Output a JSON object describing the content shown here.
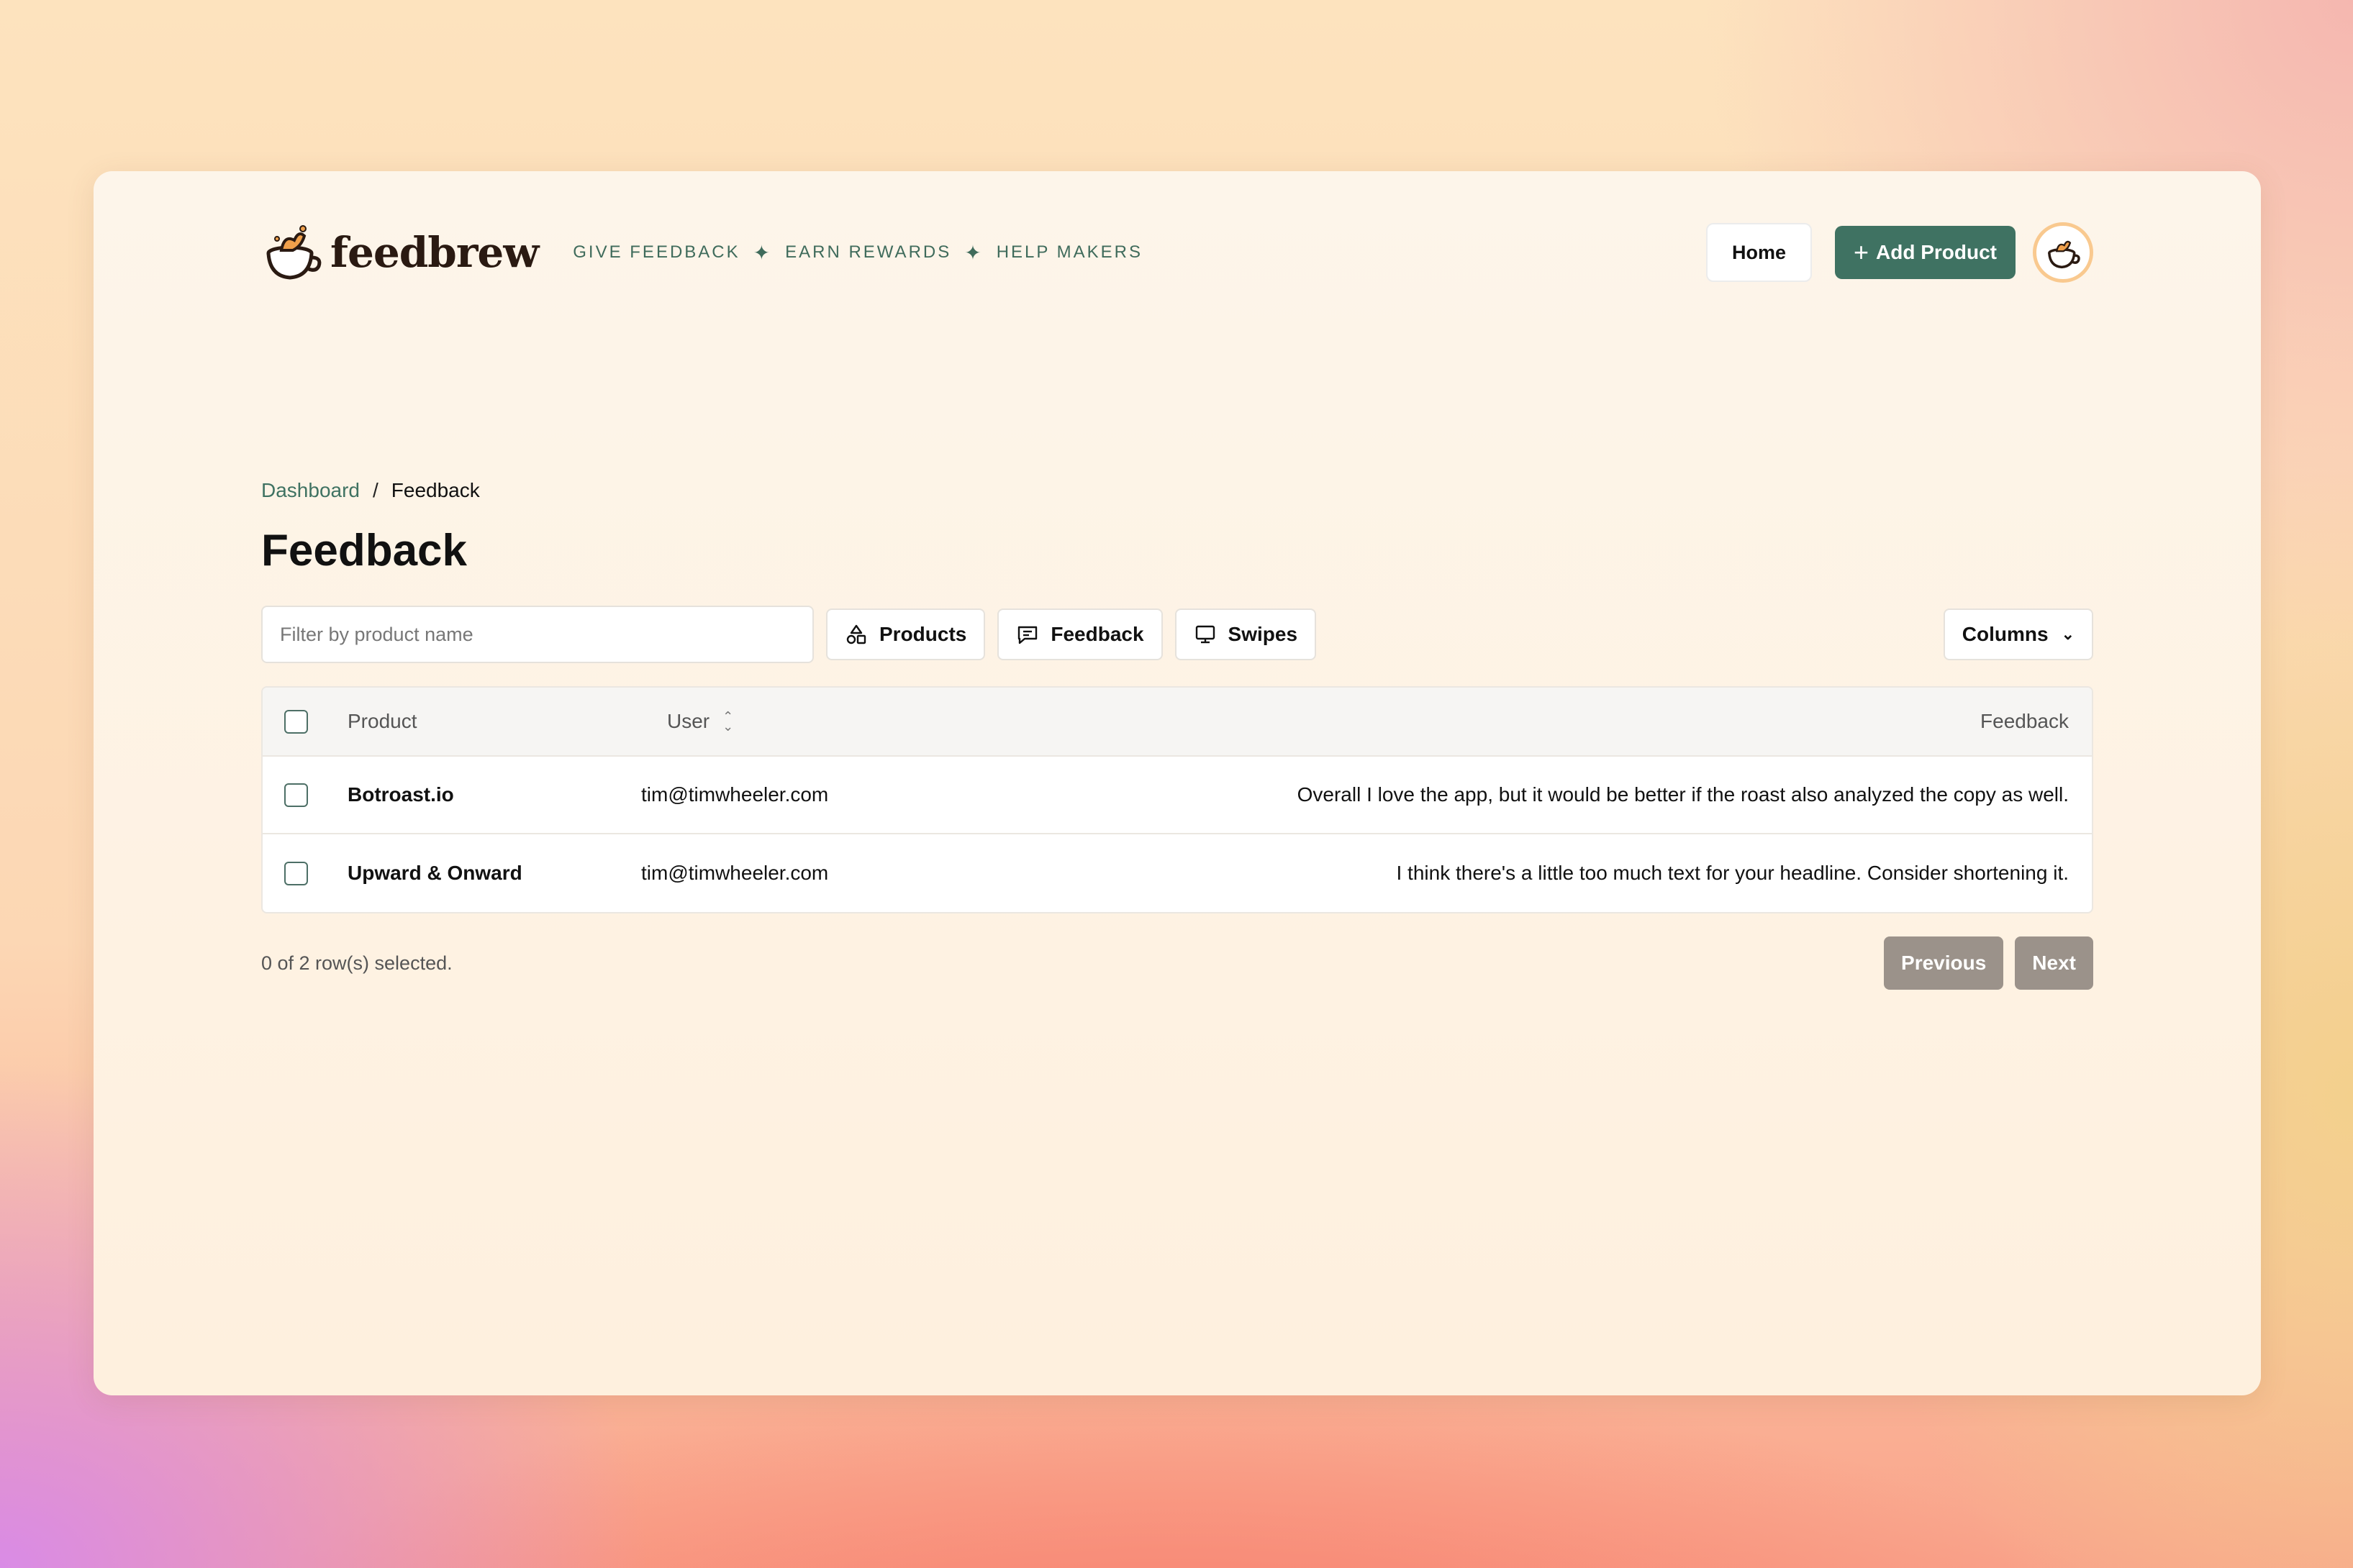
{
  "brand": {
    "name": "feedbrew",
    "tagline": [
      "GIVE FEEDBACK",
      "EARN REWARDS",
      "HELP MAKERS"
    ],
    "tagline_separator": "✦"
  },
  "header": {
    "home_label": "Home",
    "add_product_label": "Add Product"
  },
  "breadcrumb": {
    "parent": "Dashboard",
    "separator": "/",
    "current": "Feedback"
  },
  "page": {
    "title": "Feedback"
  },
  "toolbar": {
    "filter_placeholder": "Filter by product name",
    "products_label": "Products",
    "feedback_label": "Feedback",
    "swipes_label": "Swipes",
    "columns_label": "Columns"
  },
  "table": {
    "headers": {
      "product": "Product",
      "user": "User",
      "feedback": "Feedback"
    },
    "rows": [
      {
        "product": "Botroast.io",
        "user": "tim@timwheeler.com",
        "feedback": "Overall I love the app, but it would be better if the roast also analyzed the copy as well."
      },
      {
        "product": "Upward & Onward",
        "user": "tim@timwheeler.com",
        "feedback": "I think there's a little too much text for your headline. Consider shortening it."
      }
    ]
  },
  "footer": {
    "selection_text": "0 of 2 row(s) selected.",
    "previous_label": "Previous",
    "next_label": "Next"
  },
  "colors": {
    "accent": "#3f7262",
    "tagline": "#3f6b5b",
    "pager_disabled": "#9b928a"
  }
}
